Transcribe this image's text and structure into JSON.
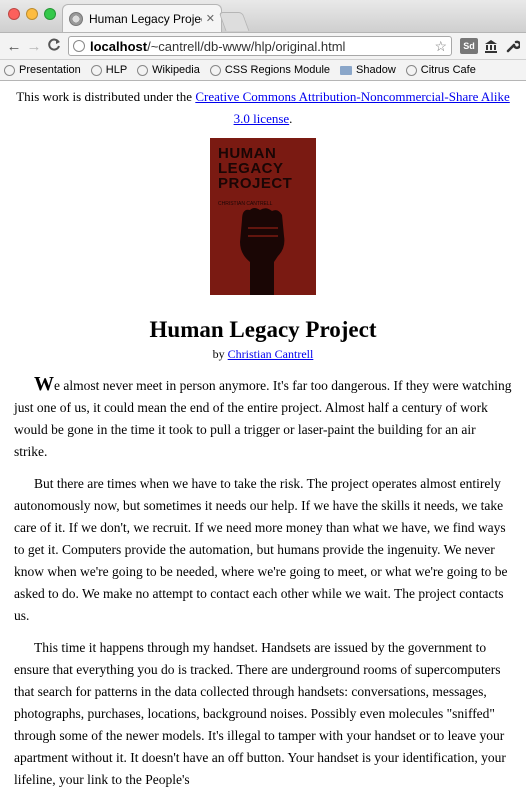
{
  "browser": {
    "tab_title": "Human Legacy Project",
    "tab_close": "✕",
    "url_host": "localhost",
    "url_path": "/~cantrell/db-www/hlp/original.html",
    "back_icon": "←",
    "forward_icon": "→",
    "reload_icon": "C",
    "sd_label": "Sd",
    "bookmarks": [
      "Presentation",
      "HLP",
      "Wikipedia",
      "CSS Regions Module",
      "Shadow",
      "Citrus Cafe"
    ]
  },
  "page": {
    "license_prefix": "This work is distributed under the ",
    "license_link": "Creative Commons Attribution-Noncommercial-Share Alike 3.0 license",
    "license_suffix": ".",
    "cover_title_1": "HUMAN",
    "cover_title_2": "LEGACY",
    "cover_title_3": "PROJECT",
    "cover_author": "CHRISTIAN CANTRELL",
    "title": "Human Legacy Project",
    "by_prefix": "by ",
    "author": "Christian Cantrell",
    "p1_cap": "W",
    "p1": "e almost never meet in person anymore. It's far too dangerous. If they were watching just one of us, it could mean the end of the entire project. Almost half a century of work would be gone in the time it took to pull a trigger or laser-paint the building for an air strike.",
    "p2": "But there are times when we have to take the risk. The project operates almost entirely autonomously now, but sometimes it needs our help. If we have the skills it needs, we take care of it. If we don't, we recruit. If we need more money than what we have, we find ways to get it. Computers provide the automation, but humans provide the ingenuity. We never know when we're going to be needed, where we're going to meet, or what we're going to be asked to do. We make no attempt to contact each other while we wait. The project contacts us.",
    "p3": "This time it happens through my handset. Handsets are issued by the government to ensure that everything you do is tracked. There are underground rooms of supercomputers that search for patterns in the data collected through handsets: conversations, messages, photographs, purchases, locations, background noises. Possibly even molecules \"sniffed\" through some of the newer models. It's illegal to tamper with your handset or to leave your apartment without it. It doesn't have an off button. Your handset is your identification, your lifeline, your link to the People's"
  }
}
